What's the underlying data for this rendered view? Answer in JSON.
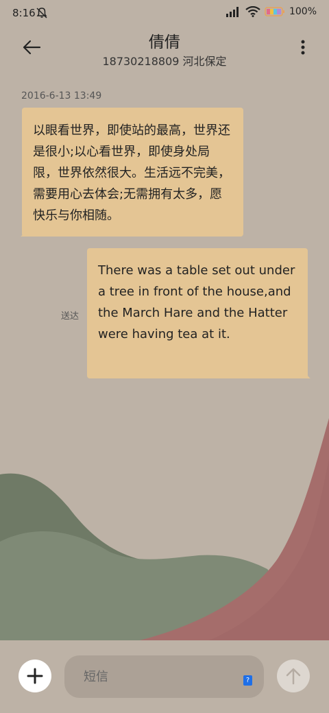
{
  "status_bar": {
    "time": "8:16",
    "battery_percent": "100%",
    "icons": [
      "bell-muted-icon",
      "signal-icon",
      "wifi-icon",
      "battery-icon"
    ]
  },
  "header": {
    "contact_name": "倩倩",
    "contact_detail": "18730218809 河北保定",
    "back_icon": "back-arrow-icon",
    "more_icon": "more-vertical-icon"
  },
  "conversation": {
    "timestamp": "2016-6-13 13:49",
    "messages": [
      {
        "direction": "incoming",
        "text": "以眼看世界，即使站的最高，世界还是很小;以心看世界，即使身处局限，世界依然很大。生活远不完美，需要用心去体会;无需拥有太多，愿快乐与你相随。"
      },
      {
        "direction": "outgoing",
        "text": "There was a table set out under a tree in front of the house,and the March Hare and the Hatter were having tea at it.",
        "status": "送达"
      }
    ]
  },
  "composer": {
    "placeholder": "短信",
    "value": "",
    "sim_badge": "?",
    "add_icon": "plus-icon",
    "send_icon": "send-arrow-icon"
  },
  "colors": {
    "background": "#bdb2a6",
    "bubble": "#e4c594",
    "input": "#aca196",
    "hill_green": "#7f8a76",
    "hill_red": "#a56d6b"
  }
}
